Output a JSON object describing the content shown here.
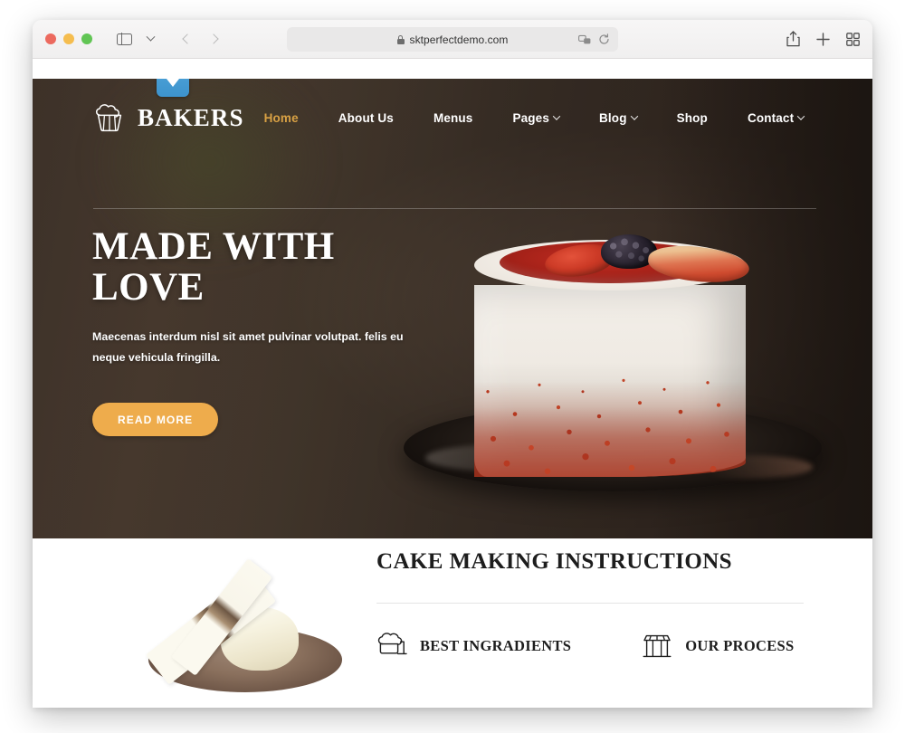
{
  "browser": {
    "url": "sktperfectdemo.com",
    "lock_icon": "lock-icon",
    "shield_icon": "privacy-shield-icon",
    "sidebar_icon": "sidebar-toggle-icon",
    "back_icon": "back-arrow-icon",
    "forward_icon": "forward-arrow-icon",
    "extensions_icon": "extensions-icon",
    "reload_icon": "reload-icon",
    "share_icon": "share-icon",
    "newtab_icon": "new-tab-icon",
    "tabs_icon": "tab-overview-icon",
    "traffic_lights": [
      "close",
      "minimize",
      "zoom"
    ]
  },
  "site": {
    "brand": {
      "name": "BAKERS",
      "logo_icon": "cupcake-icon"
    },
    "nav": [
      {
        "label": "Home",
        "active": true,
        "caret": false
      },
      {
        "label": "About Us",
        "active": false,
        "caret": false
      },
      {
        "label": "Menus",
        "active": false,
        "caret": false
      },
      {
        "label": "Pages",
        "active": false,
        "caret": true
      },
      {
        "label": "Blog",
        "active": false,
        "caret": true
      },
      {
        "label": "Shop",
        "active": false,
        "caret": false
      },
      {
        "label": "Contact",
        "active": false,
        "caret": true
      }
    ],
    "translate_widget": {
      "icon": "chevron-down-icon"
    },
    "hero": {
      "title": "MADE WITH LOVE",
      "subtitle": "Maecenas interdum nisl sit amet pulvinar volutpat. felis eu neque vehicula fringilla.",
      "cta_label": "READ MORE",
      "slides": [
        {
          "active": true
        },
        {
          "active": false
        },
        {
          "active": false
        }
      ],
      "image_alt": "red-velvet-cake-photo"
    },
    "instructions": {
      "title": "CAKE MAKING INSTRUCTIONS",
      "image_alt": "chocolate-dessert-photo",
      "features": [
        {
          "label": "BEST INGRADIENTS",
          "icon": "flour-mixer-icon"
        },
        {
          "label": "OUR PROCESS",
          "icon": "bakery-stall-icon"
        }
      ]
    }
  },
  "colors": {
    "accent_gold": "#d8a144",
    "button_gold": "#eeac4c",
    "hero_bg": "#3d3027",
    "text_dark": "#1d1d1d",
    "widget_blue": "#4ea3d8"
  }
}
